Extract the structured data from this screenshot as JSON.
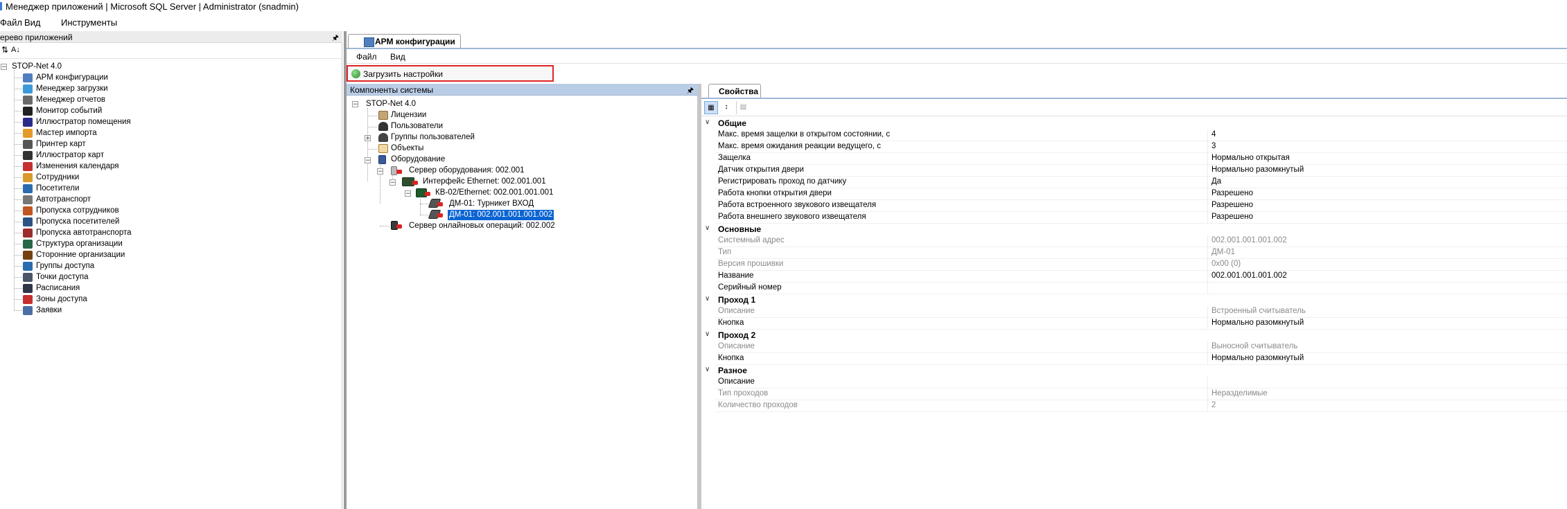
{
  "window": {
    "title": "Менеджер приложений | Microsoft SQL Server | Administrator  (snadmin)"
  },
  "main_menu": [
    "Файл",
    "Вид",
    "Инструменты"
  ],
  "left_panel": {
    "title": "ерево приложений",
    "toolbar_az": "А↓",
    "root": "STOP-Net 4.0",
    "items": [
      {
        "label": "АРМ конфигурации",
        "icon": "monitor-icon",
        "color": "#4f7fbf"
      },
      {
        "label": "Менеджер загрузки",
        "icon": "upload-icon",
        "color": "#3a9ad9"
      },
      {
        "label": "Менеджер отчетов",
        "icon": "report-icon",
        "color": "#6a6a6a"
      },
      {
        "label": "Монитор событий",
        "icon": "event-monitor-icon",
        "color": "#222222"
      },
      {
        "label": "Иллюстратор помещения",
        "icon": "room-illustrator-icon",
        "color": "#2a2a8a"
      },
      {
        "label": "Мастер импорта",
        "icon": "import-icon",
        "color": "#e39a2b"
      },
      {
        "label": "Принтер карт",
        "icon": "printer-icon",
        "color": "#555555"
      },
      {
        "label": "Иллюстратор карт",
        "icon": "card-illustrator-icon",
        "color": "#333333"
      },
      {
        "label": "Изменения календаря",
        "icon": "calendar-icon",
        "color": "#c53030"
      },
      {
        "label": "Сотрудники",
        "icon": "employees-icon",
        "color": "#d99a2b"
      },
      {
        "label": "Посетители",
        "icon": "visitors-icon",
        "color": "#2b6cb0"
      },
      {
        "label": "Автотранспорт",
        "icon": "car-icon",
        "color": "#777777"
      },
      {
        "label": "Пропуска сотрудников",
        "icon": "employee-pass-icon",
        "color": "#c05621"
      },
      {
        "label": "Пропуска посетителей",
        "icon": "visitor-pass-icon",
        "color": "#2c5282"
      },
      {
        "label": "Пропуска автотранспорта",
        "icon": "vehicle-pass-icon",
        "color": "#9b2c2c"
      },
      {
        "label": "Структура организации",
        "icon": "org-structure-icon",
        "color": "#276749"
      },
      {
        "label": "Сторонние организации",
        "icon": "external-org-icon",
        "color": "#744210"
      },
      {
        "label": "Группы доступа",
        "icon": "access-groups-icon",
        "color": "#2b6cb0"
      },
      {
        "label": "Точки доступа",
        "icon": "access-points-icon",
        "color": "#4a5568"
      },
      {
        "label": "Расписания",
        "icon": "schedule-icon",
        "color": "#2d3748"
      },
      {
        "label": "Зоны доступа",
        "icon": "access-zones-icon",
        "color": "#c53030"
      },
      {
        "label": "Заявки",
        "icon": "requests-icon",
        "color": "#4a6fa5"
      }
    ]
  },
  "doc_tab": {
    "label": "АРМ конфигурации"
  },
  "sub_menu": [
    "Файл",
    "Вид"
  ],
  "load_button": {
    "label": "Загрузить настройки"
  },
  "components": {
    "title": "Компоненты системы",
    "nodes": {
      "root": "STOP-Net 4.0",
      "licenses": "Лицензии",
      "users": "Пользователи",
      "user_groups": "Группы пользователей",
      "objects": "Объекты",
      "equipment": "Оборудование",
      "server": "Сервер оборудования: 002.001",
      "iface": "Интерфейс Ethernet: 002.001.001",
      "kb": "КВ-02/Ethernet: 002.001.001.001",
      "dm1": "ДМ-01: Турникет ВХОД",
      "dm2": "ДМ-01: 002.001.001.001.002",
      "online": "Сервер онлайновых операций: 002.002"
    }
  },
  "properties": {
    "tab": "Свойства",
    "groups": [
      {
        "name": "Общие",
        "rows": [
          {
            "k": "Макс. время защелки в открытом состоянии, с",
            "v": "4",
            "ro": false
          },
          {
            "k": "Макс. время ожидания реакции ведущего, с",
            "v": "3",
            "ro": false
          },
          {
            "k": "Защелка",
            "v": "Нормально открытая",
            "ro": false
          },
          {
            "k": "Датчик открытия двери",
            "v": "Нормально разомкнутый",
            "ro": false
          },
          {
            "k": "Регистрировать проход по датчику",
            "v": "Да",
            "ro": false
          },
          {
            "k": "Работа кнопки открытия двери",
            "v": "Разрешено",
            "ro": false
          },
          {
            "k": "Работа встроенного звукового извещателя",
            "v": "Разрешено",
            "ro": false
          },
          {
            "k": "Работа внешнего звукового извещателя",
            "v": "Разрешено",
            "ro": false
          }
        ]
      },
      {
        "name": "Основные",
        "rows": [
          {
            "k": "Системный адрес",
            "v": "002.001.001.001.002",
            "ro": true
          },
          {
            "k": "Тип",
            "v": "ДМ-01",
            "ro": true
          },
          {
            "k": "Версия прошивки",
            "v": "0x00 (0)",
            "ro": true
          },
          {
            "k": "Название",
            "v": "002.001.001.001.002",
            "ro": false
          },
          {
            "k": "Серийный номер",
            "v": "",
            "ro": false
          }
        ]
      },
      {
        "name": "Проход 1",
        "rows": [
          {
            "k": "Описание",
            "v": "Встроенный считыватель",
            "ro": true
          },
          {
            "k": "Кнопка",
            "v": "Нормально разомкнутый",
            "ro": false
          }
        ]
      },
      {
        "name": "Проход 2",
        "rows": [
          {
            "k": "Описание",
            "v": "Выносной считыватель",
            "ro": true
          },
          {
            "k": "Кнопка",
            "v": "Нормально разомкнутый",
            "ro": false
          }
        ]
      },
      {
        "name": "Разное",
        "rows": [
          {
            "k": "Описание",
            "v": "",
            "ro": false
          },
          {
            "k": "Тип проходов",
            "v": "Неразделимые",
            "ro": true
          },
          {
            "k": "Количество проходов",
            "v": "2",
            "ro": true
          }
        ]
      }
    ]
  },
  "colors": {
    "accent": "#3a7bd5",
    "selection": "#0a64d2",
    "panel_header": "#b9cde6",
    "highlight_border": "#e02424"
  }
}
